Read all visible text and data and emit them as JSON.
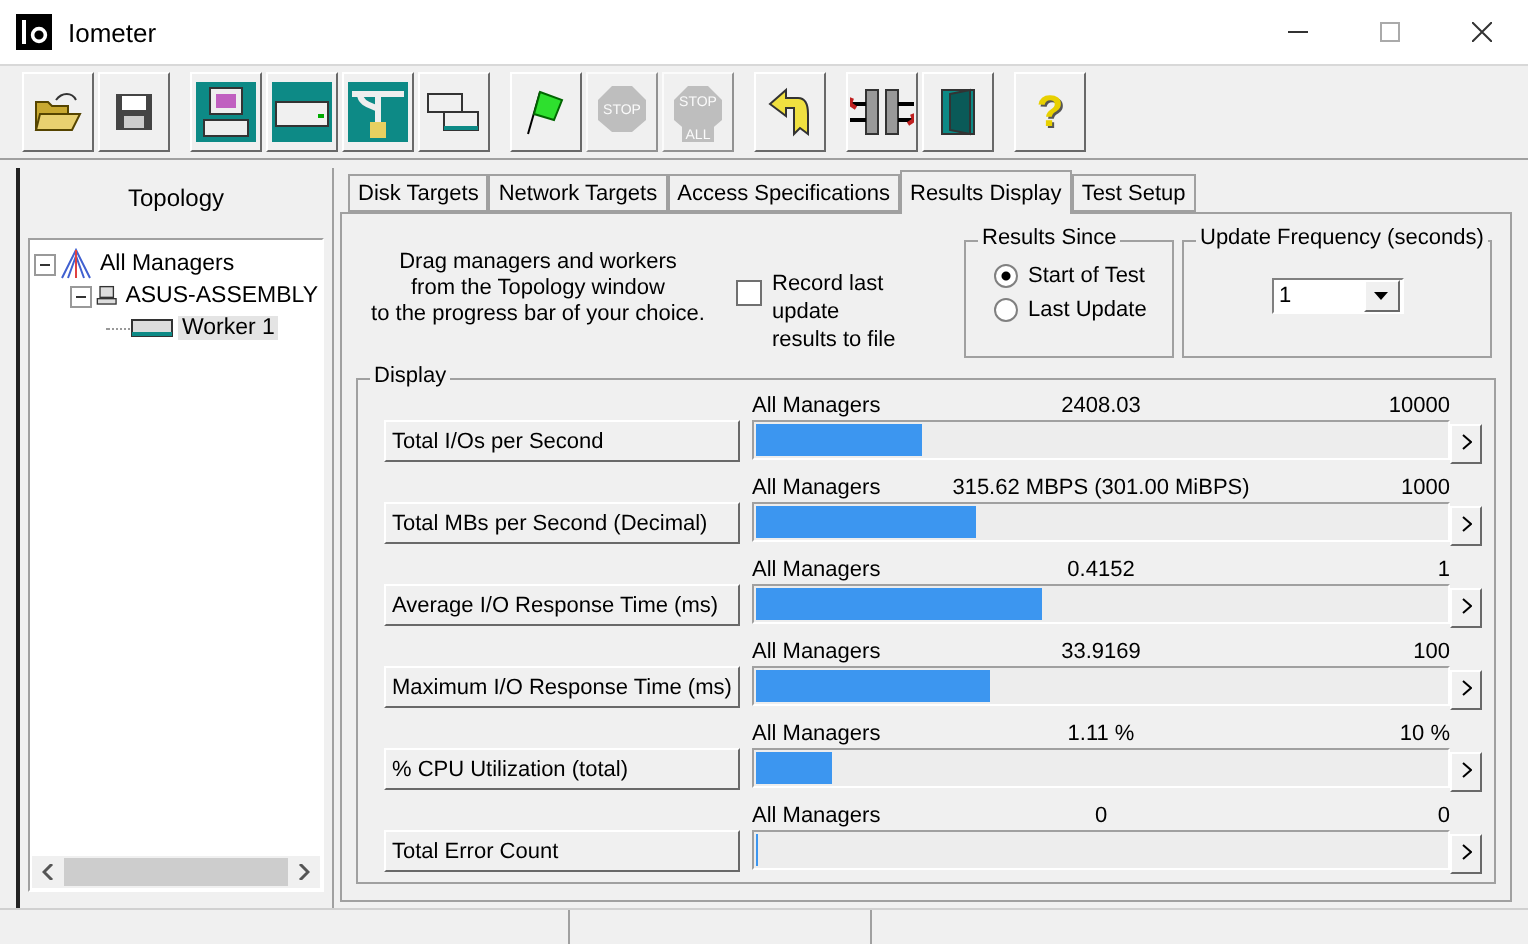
{
  "window": {
    "title": "Iometer"
  },
  "toolbar": [
    [
      {
        "kind": "open",
        "disabled": false
      },
      {
        "kind": "save",
        "disabled": false
      }
    ],
    [
      {
        "kind": "computer",
        "disabled": false
      },
      {
        "kind": "disk",
        "disabled": false
      },
      {
        "kind": "network",
        "disabled": false
      },
      {
        "kind": "copy",
        "disabled": false
      }
    ],
    [
      {
        "kind": "flag",
        "disabled": false
      },
      {
        "kind": "stop",
        "disabled": true,
        "label": "STOP"
      },
      {
        "kind": "stopall",
        "disabled": true,
        "label": "STOP",
        "sublabel": "ALL"
      }
    ],
    [
      {
        "kind": "back",
        "disabled": false
      }
    ],
    [
      {
        "kind": "split",
        "disabled": false
      },
      {
        "kind": "door",
        "disabled": false
      }
    ],
    [
      {
        "kind": "help",
        "disabled": false,
        "label": "?"
      }
    ]
  ],
  "topology": {
    "title": "Topology",
    "tree": [
      {
        "label": "All Managers",
        "kind": "managers",
        "expanded": true,
        "selected": false,
        "children": [
          {
            "label": "ASUS-ASSEMBLY",
            "kind": "computer",
            "expanded": true,
            "selected": false,
            "children": [
              {
                "label": "Worker 1",
                "kind": "worker",
                "selected": true
              }
            ]
          }
        ]
      }
    ]
  },
  "tabs": [
    {
      "label": "Disk Targets",
      "selected": false
    },
    {
      "label": "Network Targets",
      "selected": false
    },
    {
      "label": "Access Specifications",
      "selected": false
    },
    {
      "label": "Results Display",
      "selected": true
    },
    {
      "label": "Test Setup",
      "selected": false
    }
  ],
  "instructions": "Drag managers and workers\nfrom the Topology window\nto the progress bar of your choice.",
  "record": {
    "label": "Record last update\nresults to file",
    "checked": false
  },
  "results_since": {
    "title": "Results Since",
    "options": [
      {
        "label": "Start of Test",
        "selected": true
      },
      {
        "label": "Last Update",
        "selected": false
      }
    ]
  },
  "update_frequency": {
    "title": "Update Frequency (seconds)",
    "value": "1"
  },
  "display": {
    "title": "Display",
    "rows": [
      {
        "button": "Total I/Os per Second",
        "scope": "All Managers",
        "value": "2408.03",
        "max": "10000",
        "level": 0.24
      },
      {
        "button": "Total MBs per Second (Decimal)",
        "scope": "All Managers",
        "value": "315.62 MBPS (301.00 MiBPS)",
        "max": "1000",
        "level": 0.32
      },
      {
        "button": "Average I/O Response Time (ms)",
        "scope": "All Managers",
        "value": "0.4152",
        "max": "1",
        "level": 0.4152
      },
      {
        "button": "Maximum I/O Response Time (ms)",
        "scope": "All Managers",
        "value": "33.9169",
        "max": "100",
        "level": 0.339
      },
      {
        "button": "% CPU Utilization (total)",
        "scope": "All Managers",
        "value": "1.11 %",
        "max": "10 %",
        "level": 0.111
      },
      {
        "button": "Total Error Count",
        "scope": "All Managers",
        "value": "0",
        "max": "0",
        "level": 0
      }
    ]
  }
}
